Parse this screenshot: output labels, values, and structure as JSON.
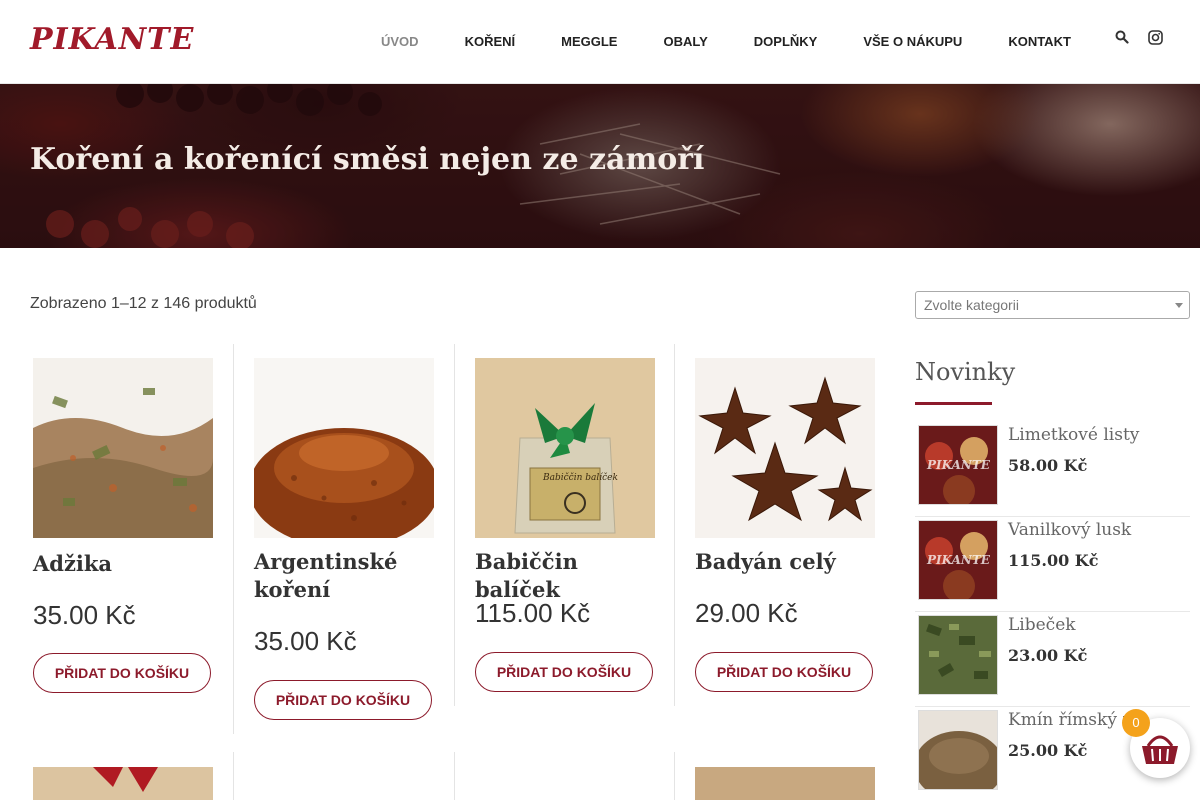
{
  "brand": {
    "logo_text": "PIKANTE",
    "accent": "#8c1a2b"
  },
  "nav": {
    "items": [
      {
        "label": "ÚVOD",
        "active": true
      },
      {
        "label": "KOŘENÍ"
      },
      {
        "label": "MEGGLE"
      },
      {
        "label": "OBALY"
      },
      {
        "label": "DOPLŇKY"
      },
      {
        "label": "VŠE O NÁKUPU"
      },
      {
        "label": "KONTAKT"
      }
    ],
    "icons": [
      "search-icon",
      "instagram-icon"
    ]
  },
  "hero": {
    "title": "Koření a kořenící směsi nejen ze zámoří"
  },
  "shop": {
    "result_count": "Zobrazeno 1–12 z 146 produktů",
    "products": [
      {
        "name": "Adžika",
        "price": "35.00 Kč",
        "button": "PŘIDAT DO KOŠÍKU"
      },
      {
        "name": "Argentinské koření",
        "price": "35.00 Kč",
        "button": "PŘIDAT DO KOŠÍKU"
      },
      {
        "name": "Babiččin balíček",
        "price": "115.00 Kč",
        "button": "PŘIDAT DO KOŠÍKU",
        "label": "Babiččin balíček"
      },
      {
        "name": "Badyán celý",
        "price": "29.00 Kč",
        "button": "PŘIDAT DO KOŠÍKU"
      }
    ]
  },
  "sidebar": {
    "category_placeholder": "Zvolte kategorii",
    "title": "Novinky",
    "items": [
      {
        "name": "Limetkové listy",
        "price": "58.00 Kč",
        "thumb_text": "PIKANTE"
      },
      {
        "name": "Vanilkový lusk",
        "price": "115.00 Kč",
        "thumb_text": "PIKANTE"
      },
      {
        "name": "Libeček",
        "price": "23.00 Kč"
      },
      {
        "name": "Kmín římský m",
        "price": "25.00 Kč"
      }
    ]
  },
  "cart": {
    "count": "0",
    "badge_color": "#f4a21b"
  }
}
